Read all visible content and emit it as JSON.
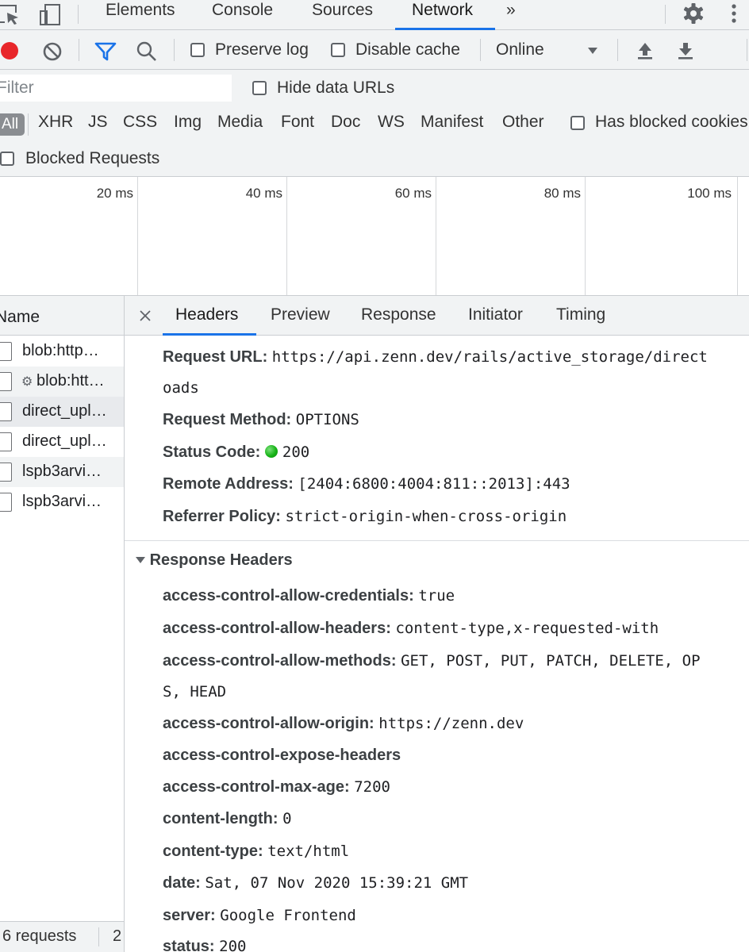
{
  "top_tabs": [
    {
      "label": "Elements"
    },
    {
      "label": "Console"
    },
    {
      "label": "Sources"
    },
    {
      "label": "Network",
      "active": true
    },
    {
      "label": "»"
    }
  ],
  "toolbar": {
    "preserve_log": "Preserve log",
    "disable_cache": "Disable cache",
    "throttling": "Online"
  },
  "filter": {
    "placeholder": "Filter",
    "hide_data_urls": "Hide data URLs"
  },
  "types": {
    "all": "All",
    "items": [
      "XHR",
      "JS",
      "CSS",
      "Img",
      "Media",
      "Font",
      "Doc",
      "WS",
      "Manifest",
      "Other"
    ],
    "has_blocked_cookies": "Has blocked cookies"
  },
  "blocked_requests": "Blocked Requests",
  "overview": {
    "ticks": [
      "20 ms",
      "40 ms",
      "60 ms",
      "80 ms",
      "100 ms"
    ]
  },
  "request_list": {
    "header": "Name",
    "items": [
      {
        "name": "blob:http…"
      },
      {
        "name": "blob:htt…",
        "gear": true
      },
      {
        "name": "direct_upl…",
        "selected": true
      },
      {
        "name": "direct_upl…"
      },
      {
        "name": "lspb3arvi…"
      },
      {
        "name": "lspb3arvi…"
      }
    ],
    "summary": "6 requests",
    "summary_tail": "2"
  },
  "detail_tabs": [
    "Headers",
    "Preview",
    "Response",
    "Initiator",
    "Timing"
  ],
  "general": {
    "request_url": {
      "key": "Request URL:",
      "value": "https://api.zenn.dev/rails/active_storage/direct",
      "value_cont": "oads"
    },
    "request_method": {
      "key": "Request Method:",
      "value": "OPTIONS"
    },
    "status_code": {
      "key": "Status Code:",
      "value": "200"
    },
    "remote_address": {
      "key": "Remote Address:",
      "value": "[2404:6800:4004:811::2013]:443"
    },
    "referrer_policy": {
      "key": "Referrer Policy:",
      "value": "strict-origin-when-cross-origin"
    }
  },
  "response_headers": {
    "title": "Response Headers",
    "items": [
      {
        "key": "access-control-allow-credentials:",
        "value": "true"
      },
      {
        "key": "access-control-allow-headers:",
        "value": "content-type,x-requested-with"
      },
      {
        "key": "access-control-allow-methods:",
        "value": "GET, POST, PUT, PATCH, DELETE, OP",
        "value_cont": "S, HEAD"
      },
      {
        "key": "access-control-allow-origin:",
        "value": "https://zenn.dev"
      },
      {
        "key": "access-control-expose-headers",
        "value": ""
      },
      {
        "key": "access-control-max-age:",
        "value": "7200"
      },
      {
        "key": "content-length:",
        "value": "0"
      },
      {
        "key": "content-type:",
        "value": "text/html"
      },
      {
        "key": "date:",
        "value": "Sat, 07 Nov 2020 15:39:21 GMT"
      },
      {
        "key": "server:",
        "value": "Google Frontend"
      },
      {
        "key": "status:",
        "value": "200"
      }
    ]
  },
  "colors": {
    "accent": "#1a73e8",
    "record": "#e8262a",
    "status_ok": "#17b317"
  },
  "icons": [
    "inspect-icon",
    "device-icon",
    "settings-gear-icon",
    "more-vert-icon",
    "record-icon",
    "clear-icon",
    "filter-icon",
    "search-icon",
    "dropdown-arrow-icon",
    "import-icon",
    "export-icon",
    "close-icon",
    "triangle-down-icon",
    "gear-icon",
    "file-icon"
  ]
}
